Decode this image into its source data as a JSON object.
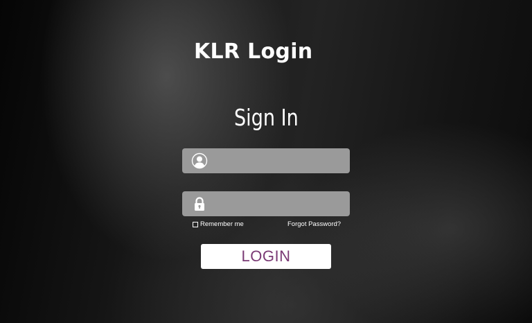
{
  "header": {
    "brand": "KLR Login",
    "title": "Sign In"
  },
  "form": {
    "username": {
      "value": "",
      "placeholder": "",
      "icon": "user-icon"
    },
    "password": {
      "value": "",
      "placeholder": "",
      "icon": "lock-icon"
    },
    "remember_label": "Remember me",
    "forgot_label": "Forgot Password?",
    "login_label": "LOGIN"
  },
  "colors": {
    "field_background": "#9a9a9a",
    "button_background": "#ffffff",
    "button_text": "#7a3a75"
  }
}
